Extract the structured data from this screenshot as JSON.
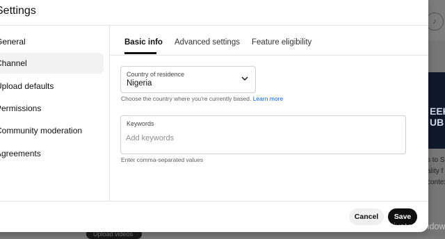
{
  "dialog": {
    "title": "Settings"
  },
  "sidebar": {
    "items": [
      {
        "label": "General"
      },
      {
        "label": "Channel",
        "active": true
      },
      {
        "label": "Upload defaults"
      },
      {
        "label": "Permissions"
      },
      {
        "label": "Community moderation"
      },
      {
        "label": "Agreements"
      }
    ]
  },
  "tabs": [
    {
      "label": "Basic info",
      "active": true
    },
    {
      "label": "Advanced settings"
    },
    {
      "label": "Feature eligibility"
    }
  ],
  "country": {
    "label": "Country of residence",
    "value": "Nigeria",
    "help": "Choose the country where you're currently based.",
    "help_link": "Learn more"
  },
  "keywords": {
    "label": "Keywords",
    "placeholder": "Add keywords",
    "value": "",
    "help": "Enter comma-separated values"
  },
  "footer": {
    "cancel_label": "Cancel",
    "save_label": "Save"
  },
  "background": {
    "banner_line1": "EEK",
    "banner_line2": "UB",
    "text_lines": [
      "s to S",
      "ality f",
      "contex"
    ],
    "upload_label": "Upload videos"
  },
  "watermark": "Activate Windows",
  "colors": {
    "accent": "#065fd4",
    "primary_button": "#0f0f0f",
    "active_nav": "#f2f2f2"
  }
}
